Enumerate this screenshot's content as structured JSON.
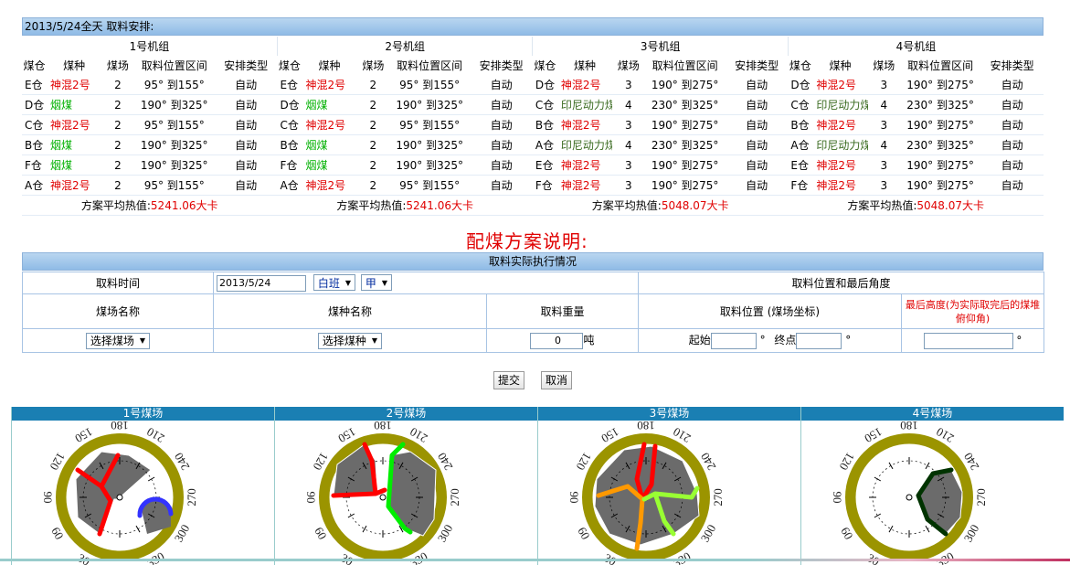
{
  "schedule": {
    "header": "2013/5/24全天 取料安排:",
    "columns": [
      "煤仓",
      "煤种",
      "煤场",
      "取料位置区间",
      "安排类型"
    ],
    "groups": [
      {
        "name": "1号机组",
        "avg_label": "方案平均热值:",
        "avg_value": "5241.06大卡",
        "rows": [
          {
            "bin": "E仓",
            "coal": "神混2号",
            "yard": "2",
            "range": "95° 到155°",
            "type": "自动",
            "coal_color": "red"
          },
          {
            "bin": "D仓",
            "coal": "烟煤",
            "yard": "2",
            "range": "190° 到325°",
            "type": "自动",
            "coal_color": "green"
          },
          {
            "bin": "C仓",
            "coal": "神混2号",
            "yard": "2",
            "range": "95° 到155°",
            "type": "自动",
            "coal_color": "red"
          },
          {
            "bin": "B仓",
            "coal": "烟煤",
            "yard": "2",
            "range": "190° 到325°",
            "type": "自动",
            "coal_color": "green"
          },
          {
            "bin": "F仓",
            "coal": "烟煤",
            "yard": "2",
            "range": "190° 到325°",
            "type": "自动",
            "coal_color": "green"
          },
          {
            "bin": "A仓",
            "coal": "神混2号",
            "yard": "2",
            "range": "95° 到155°",
            "type": "自动",
            "coal_color": "red"
          }
        ]
      },
      {
        "name": "2号机组",
        "avg_label": "方案平均热值:",
        "avg_value": "5241.06大卡",
        "rows": [
          {
            "bin": "E仓",
            "coal": "神混2号",
            "yard": "2",
            "range": "95° 到155°",
            "type": "自动",
            "coal_color": "red"
          },
          {
            "bin": "D仓",
            "coal": "烟煤",
            "yard": "2",
            "range": "190° 到325°",
            "type": "自动",
            "coal_color": "green"
          },
          {
            "bin": "C仓",
            "coal": "神混2号",
            "yard": "2",
            "range": "95° 到155°",
            "type": "自动",
            "coal_color": "red"
          },
          {
            "bin": "B仓",
            "coal": "烟煤",
            "yard": "2",
            "range": "190° 到325°",
            "type": "自动",
            "coal_color": "green"
          },
          {
            "bin": "F仓",
            "coal": "烟煤",
            "yard": "2",
            "range": "190° 到325°",
            "type": "自动",
            "coal_color": "green"
          },
          {
            "bin": "A仓",
            "coal": "神混2号",
            "yard": "2",
            "range": "95° 到155°",
            "type": "自动",
            "coal_color": "red"
          }
        ]
      },
      {
        "name": "3号机组",
        "avg_label": "方案平均热值:",
        "avg_value": "5048.07大卡",
        "rows": [
          {
            "bin": "D仓",
            "coal": "神混2号",
            "yard": "3",
            "range": "190° 到275°",
            "type": "自动",
            "coal_color": "red"
          },
          {
            "bin": "C仓",
            "coal": "印尼动力煤",
            "yard": "4",
            "range": "230° 到325°",
            "type": "自动",
            "coal_color": "olive"
          },
          {
            "bin": "B仓",
            "coal": "神混2号",
            "yard": "3",
            "range": "190° 到275°",
            "type": "自动",
            "coal_color": "red"
          },
          {
            "bin": "A仓",
            "coal": "印尼动力煤",
            "yard": "4",
            "range": "230° 到325°",
            "type": "自动",
            "coal_color": "olive"
          },
          {
            "bin": "E仓",
            "coal": "神混2号",
            "yard": "3",
            "range": "190° 到275°",
            "type": "自动",
            "coal_color": "red"
          },
          {
            "bin": "F仓",
            "coal": "神混2号",
            "yard": "3",
            "range": "190° 到275°",
            "type": "自动",
            "coal_color": "red"
          }
        ]
      },
      {
        "name": "4号机组",
        "avg_label": "方案平均热值:",
        "avg_value": "5048.07大卡",
        "rows": [
          {
            "bin": "D仓",
            "coal": "神混2号",
            "yard": "3",
            "range": "190° 到275°",
            "type": "自动",
            "coal_color": "red"
          },
          {
            "bin": "C仓",
            "coal": "印尼动力煤",
            "yard": "4",
            "range": "230° 到325°",
            "type": "自动",
            "coal_color": "olive"
          },
          {
            "bin": "B仓",
            "coal": "神混2号",
            "yard": "3",
            "range": "190° 到275°",
            "type": "自动",
            "coal_color": "red"
          },
          {
            "bin": "A仓",
            "coal": "印尼动力煤",
            "yard": "4",
            "range": "230° 到325°",
            "type": "自动",
            "coal_color": "olive"
          },
          {
            "bin": "E仓",
            "coal": "神混2号",
            "yard": "3",
            "range": "190° 到275°",
            "type": "自动",
            "coal_color": "red"
          },
          {
            "bin": "F仓",
            "coal": "神混2号",
            "yard": "3",
            "range": "190° 到275°",
            "type": "自动",
            "coal_color": "red"
          }
        ]
      }
    ]
  },
  "plan_title": "配煤方案说明:",
  "execution": {
    "title": "取料实际执行情况",
    "time_label": "取料时间",
    "date_value": "2013/5/24",
    "shift_value": "白班",
    "team_value": "甲",
    "position_header": "取料位置和最后角度",
    "yard_name_label": "煤场名称",
    "coal_name_label": "煤种名称",
    "weight_label": "取料重量",
    "position_label": "取料位置 (煤场坐标)",
    "height_label": "最后高度(为实际取完后的煤堆俯仰角)",
    "yard_select": "选择煤场",
    "coal_select": "选择煤种",
    "weight_value": "0",
    "weight_unit": "吨",
    "start_label": "起始",
    "end_label": "终点",
    "degree": "°",
    "submit": "提交",
    "cancel": "取消"
  },
  "yards": [
    {
      "title": "1号煤场"
    },
    {
      "title": "2号煤场"
    },
    {
      "title": "3号煤场"
    },
    {
      "title": "4号煤场"
    }
  ],
  "dial_labels": [
    "0",
    "30",
    "60",
    "90",
    "120",
    "150",
    "180",
    "210",
    "240",
    "270",
    "300",
    "330"
  ],
  "colors": {
    "ring": "#9b9400",
    "pile": "#6b6b6b",
    "header_bg": "#1a7fb3",
    "accent_red": "#e00000"
  }
}
